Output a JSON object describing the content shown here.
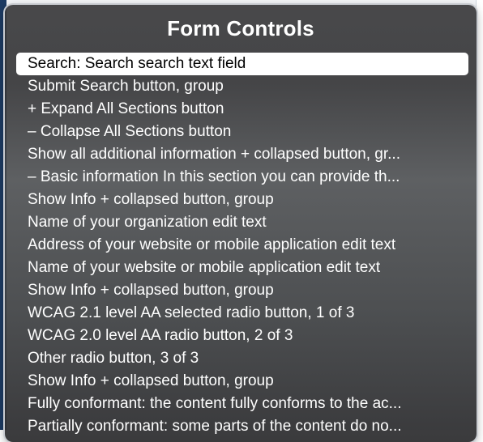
{
  "rotor": {
    "title": "Form Controls",
    "items": [
      {
        "label": "Search: Search search text field",
        "selected": true
      },
      {
        "label": "Submit Search button, group"
      },
      {
        "label": "+ Expand All Sections button"
      },
      {
        "label": "– Collapse All Sections button"
      },
      {
        "label": "Show all additional information + collapsed button, gr..."
      },
      {
        "label": "– Basic information In this section you can provide th..."
      },
      {
        "label": "Show Info + collapsed button, group"
      },
      {
        "label": "Name of your organization edit text"
      },
      {
        "label": "Address of your website or mobile application edit text"
      },
      {
        "label": "Name of your website or mobile application edit text"
      },
      {
        "label": "Show Info + collapsed button, group"
      },
      {
        "label": "WCAG 2.1 level AA selected radio button, 1 of 3"
      },
      {
        "label": "WCAG 2.0 level AA radio button, 2 of 3"
      },
      {
        "label": "Other radio button, 3 of 3"
      },
      {
        "label": "Show Info + collapsed button, group"
      },
      {
        "label": "Fully conformant: the content fully conforms to the ac..."
      },
      {
        "label": "Partially conformant: some parts of the content do no..."
      }
    ]
  },
  "colors": {
    "panel_text": "#ffffff",
    "selected_bg": "#ffffff",
    "selected_text": "#000000"
  }
}
